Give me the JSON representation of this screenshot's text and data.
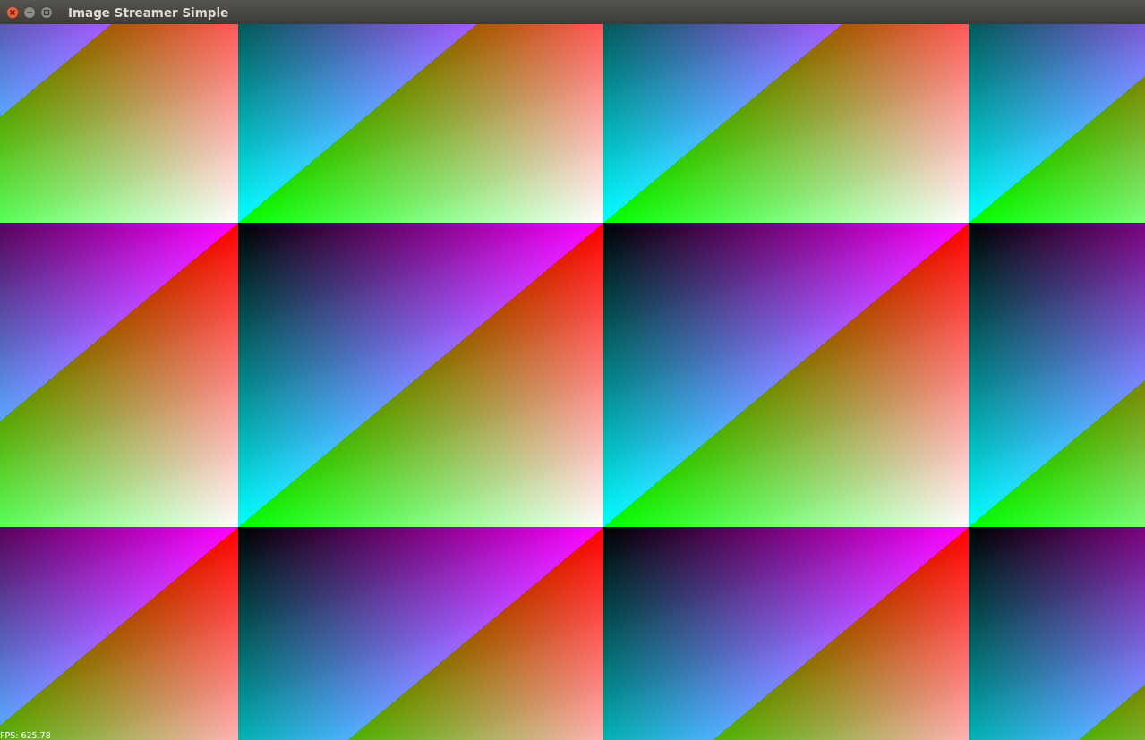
{
  "window": {
    "title": "Image Streamer Simple"
  },
  "overlay": {
    "fps": "FPS: 625.78"
  }
}
